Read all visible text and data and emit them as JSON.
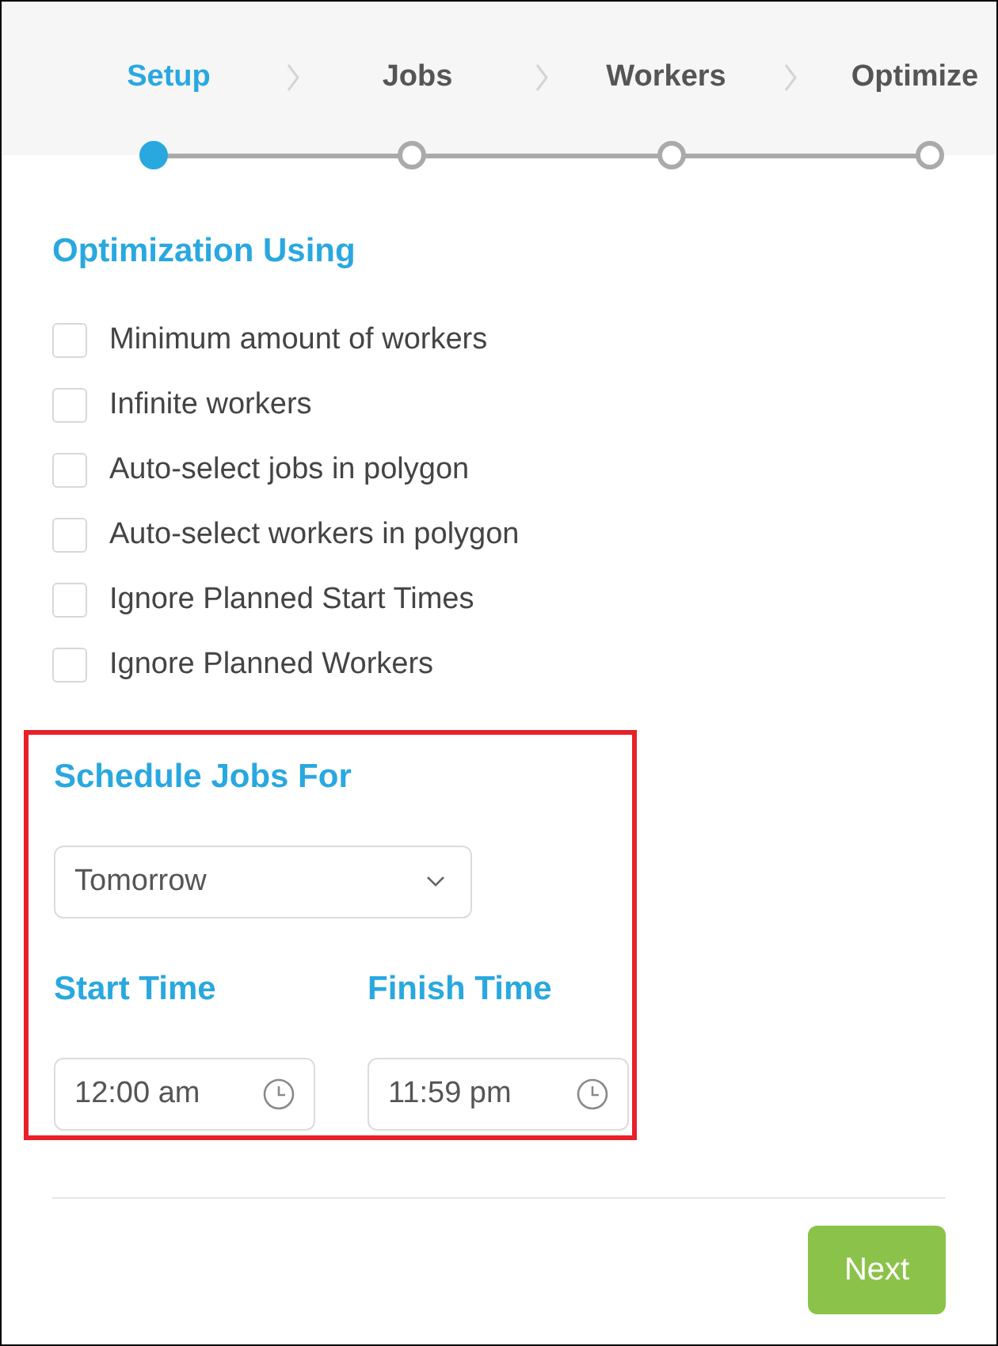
{
  "steps": [
    {
      "label": "Setup",
      "selected": true
    },
    {
      "label": "Jobs",
      "selected": false
    },
    {
      "label": "Workers",
      "selected": false
    },
    {
      "label": "Optimize",
      "selected": false
    }
  ],
  "optimization": {
    "title": "Optimization Using",
    "options": [
      {
        "label": "Minimum amount of workers",
        "checked": false
      },
      {
        "label": "Infinite workers",
        "checked": false
      },
      {
        "label": "Auto-select jobs in polygon",
        "checked": false
      },
      {
        "label": "Auto-select workers in polygon",
        "checked": false
      },
      {
        "label": "Ignore Planned Start Times",
        "checked": false
      },
      {
        "label": "Ignore Planned Workers",
        "checked": false
      }
    ]
  },
  "schedule": {
    "title": "Schedule Jobs For",
    "value": "Tomorrow",
    "start": {
      "label": "Start Time",
      "value": "12:00 am"
    },
    "finish": {
      "label": "Finish Time",
      "value": "11:59 pm"
    }
  },
  "next_button": "Next"
}
